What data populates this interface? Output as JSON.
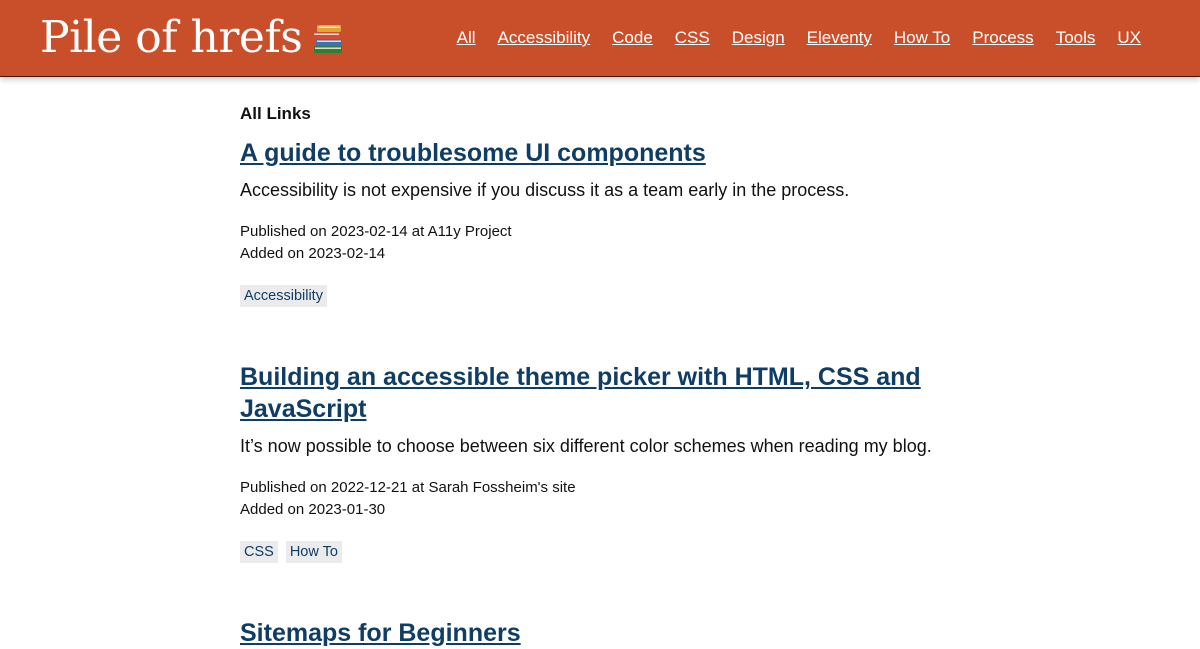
{
  "header": {
    "logo_text": "Pile of hrefs",
    "logo_icon": "books-icon",
    "brand_color": "#c94e2a",
    "nav": [
      {
        "label": "All"
      },
      {
        "label": "Accessibility"
      },
      {
        "label": "Code"
      },
      {
        "label": "CSS"
      },
      {
        "label": "Design"
      },
      {
        "label": "Eleventy"
      },
      {
        "label": "How To"
      },
      {
        "label": "Process"
      },
      {
        "label": "Tools"
      },
      {
        "label": "UX"
      }
    ]
  },
  "main": {
    "heading": "All Links",
    "link_color": "#0f3d66",
    "entries": [
      {
        "title": "A guide to troublesome UI components",
        "description": "Accessibility is not expensive if you discuss it as a team early in the process.",
        "published": "Published on 2023-02-14 at A11y Project",
        "added": "Added on 2023-02-14",
        "tags": [
          "Accessibility"
        ]
      },
      {
        "title": "Building an accessible theme picker with HTML, CSS and JavaScript",
        "description": "It’s now possible to choose between six different color schemes when reading my blog.",
        "published": "Published on 2022-12-21 at Sarah Fossheim's site",
        "added": "Added on 2023-01-30",
        "tags": [
          "CSS",
          "How To"
        ]
      },
      {
        "title": "Sitemaps for Beginners"
      }
    ]
  }
}
